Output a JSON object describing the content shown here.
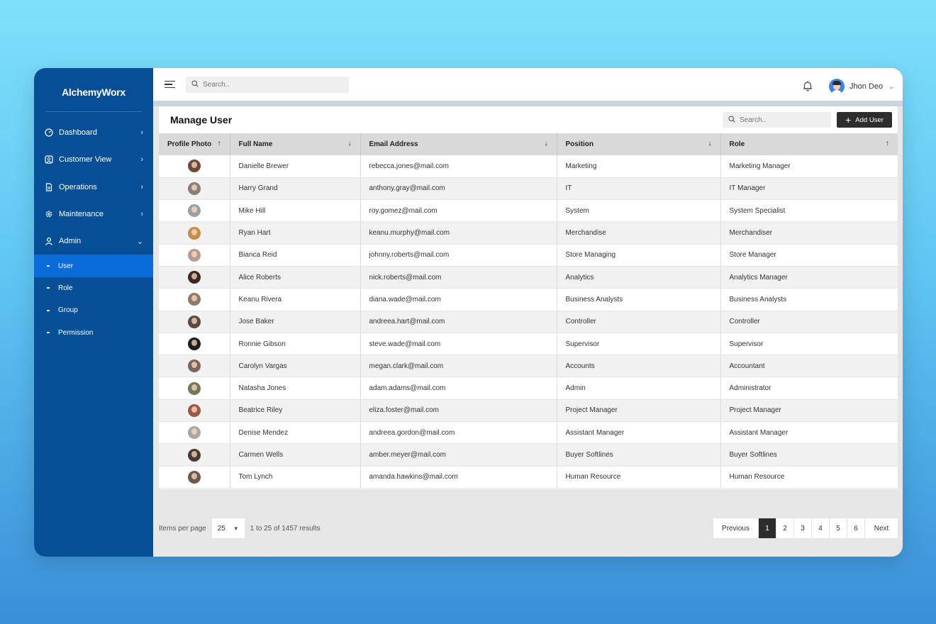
{
  "brand": "AlchemyWorx",
  "colors": {
    "sidebar": "#064f96",
    "active": "#0a6cd8",
    "button": "#2d2d2d"
  },
  "sidebar": {
    "items": [
      {
        "label": "Dashboard",
        "icon": "gauge-icon"
      },
      {
        "label": "Customer View",
        "icon": "user-card-icon"
      },
      {
        "label": "Operations",
        "icon": "document-icon"
      },
      {
        "label": "Maintenance",
        "icon": "gear-icon"
      },
      {
        "label": "Admin",
        "icon": "person-icon"
      }
    ],
    "sub_items": [
      {
        "label": "User"
      },
      {
        "label": "Role"
      },
      {
        "label": "Group"
      },
      {
        "label": "Permission"
      }
    ]
  },
  "topbar": {
    "search_placeholder": "Search..",
    "user_name": "Jhon Deo"
  },
  "card": {
    "title": "Manage User",
    "search_placeholder": "Search..",
    "add_label": "Add User"
  },
  "table": {
    "columns": [
      {
        "label": "Profile Photo",
        "sort": "↑"
      },
      {
        "label": "Full Name",
        "sort": "↓"
      },
      {
        "label": "Email Address",
        "sort": "↓"
      },
      {
        "label": "Position",
        "sort": "↓"
      },
      {
        "label": "Role",
        "sort": "↑"
      }
    ],
    "rows": [
      {
        "name": "Danielle Brewer",
        "email": "rebecca.jones@mail.com",
        "position": "Marketing",
        "role": "Marketing Manager",
        "avatar": "#6b4a3a"
      },
      {
        "name": "Harry Grand",
        "email": "anthony.gray@mail.com",
        "position": "IT",
        "role": "IT Manager",
        "avatar": "#8a7f78"
      },
      {
        "name": "Mike Hill",
        "email": "roy.gomez@mail.com",
        "position": "System",
        "role": "System Specialist",
        "avatar": "#9aa0a4"
      },
      {
        "name": "Ryan Hart",
        "email": "keanu.murphy@mail.com",
        "position": "Merchandise",
        "role": "Merchandiser",
        "avatar": "#c58b4b"
      },
      {
        "name": "Bianca Reid",
        "email": "johnny.roberts@mail.com",
        "position": "Store Managing",
        "role": "Store Manager",
        "avatar": "#b89a92"
      },
      {
        "name": "Alice Roberts",
        "email": "nick.roberts@mail.com",
        "position": "Analytics",
        "role": "Analytics Manager",
        "avatar": "#3a2a22"
      },
      {
        "name": "Keanu Rivera",
        "email": "diana.wade@mail.com",
        "position": "Business Analysts",
        "role": "Business Analysts",
        "avatar": "#8f7a6d"
      },
      {
        "name": "Jose Baker",
        "email": "andreea.hart@mail.com",
        "position": "Controller",
        "role": "Controller",
        "avatar": "#5a4a40"
      },
      {
        "name": "Ronnie Gibson",
        "email": "steve.wade@mail.com",
        "position": "Supervisor",
        "role": "Supervisor",
        "avatar": "#1e1e1e"
      },
      {
        "name": "Carolyn Vargas",
        "email": "megan.clark@mail.com",
        "position": "Accounts",
        "role": "Accountant",
        "avatar": "#7a6460"
      },
      {
        "name": "Natasha Jones",
        "email": "adam.adams@mail.com",
        "position": "Admin",
        "role": "Administrator",
        "avatar": "#6b7a5a"
      },
      {
        "name": "Beatrice Riley",
        "email": "eliza.foster@mail.com",
        "position": "Project Manager",
        "role": "Project Manager",
        "avatar": "#9a5a4a"
      },
      {
        "name": "Denise Mendez",
        "email": "andreea.gordon@mail.com",
        "position": "Assistant Manager",
        "role": "Assistant Manager",
        "avatar": "#a8a8a8"
      },
      {
        "name": "Carmen Wells",
        "email": "amber.meyer@mail.com",
        "position": "Buyer Softlines",
        "role": "Buyer Softlines",
        "avatar": "#4a3a32"
      },
      {
        "name": "Tom Lynch",
        "email": "amanda.hawkins@mail.com",
        "position": "Human Resource",
        "role": "Human Resource",
        "avatar": "#6a5a4e"
      }
    ]
  },
  "pager": {
    "items_per_page_label": "Items per page",
    "per_page_value": "25",
    "results_text": "1 to 25 of 1457 results",
    "previous": "Previous",
    "next": "Next",
    "pages": [
      "1",
      "2",
      "3",
      "4",
      "5",
      "6"
    ],
    "current": "1"
  }
}
